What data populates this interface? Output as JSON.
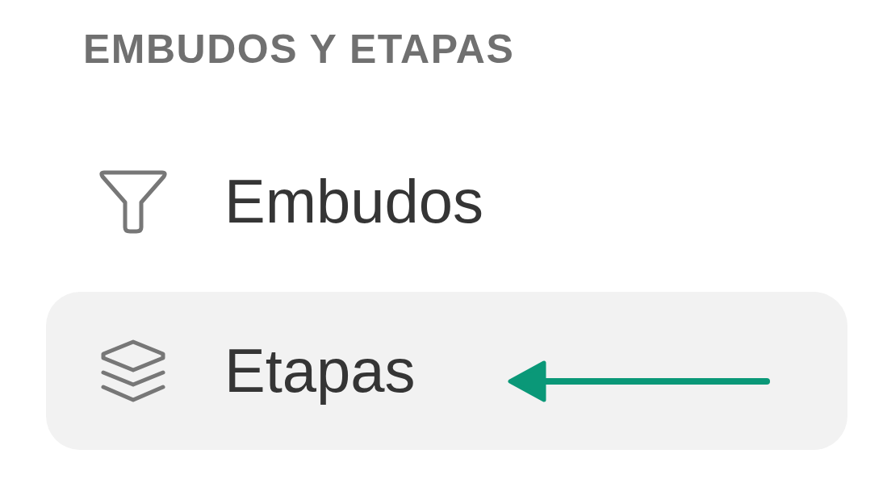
{
  "section": {
    "title": "EMBUDOS Y ETAPAS"
  },
  "items": [
    {
      "label": "Embudos",
      "kind": "funnel",
      "selected": false,
      "arrow": false
    },
    {
      "label": "Etapas",
      "kind": "layers",
      "selected": true,
      "arrow": true
    }
  ]
}
